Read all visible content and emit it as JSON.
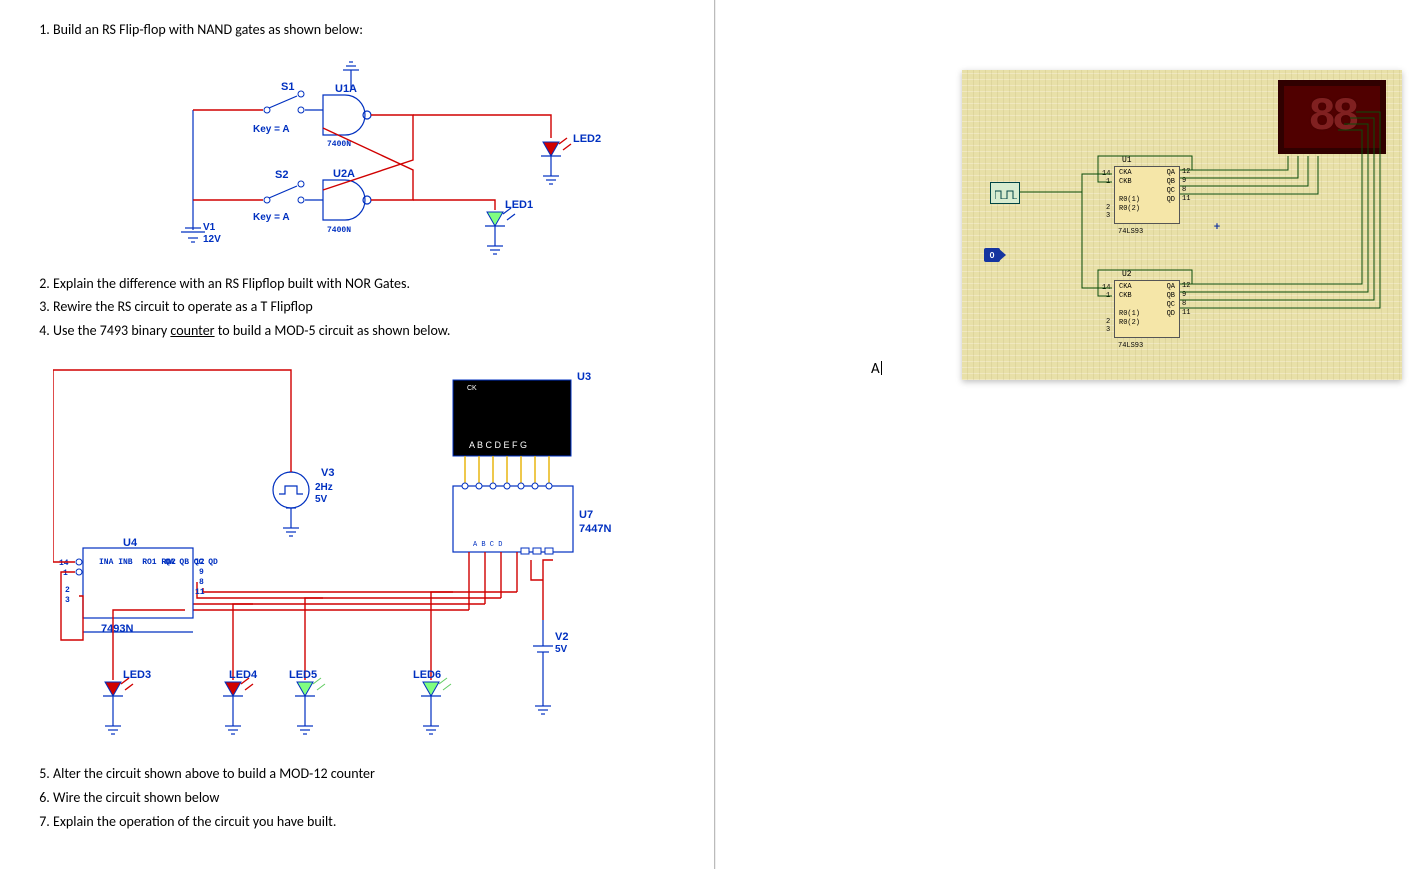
{
  "doc": {
    "items": {
      "q1": "Build an RS Flip-flop with NAND gates as shown below:",
      "q2": "Explain the difference with an RS Flipflop built with NOR Gates.",
      "q3": "Rewire the RS circuit to operate as a T Flipflop",
      "q4_pre": "Use the 7493 binary ",
      "q4_u": "counter",
      "q4_post": " to build a MOD-5 circuit as shown below.",
      "q5": "Alter the circuit shown above to build a MOD-12 counter",
      "q6": "Wire the circuit shown below",
      "q7": "Explain the operation of the circuit you have built."
    },
    "diagram1": {
      "s1": "S1",
      "s2": "S2",
      "u1a": "U1A",
      "u2a": "U2A",
      "n7400": "7400N",
      "keyA": "Key = A",
      "v1": "V1",
      "v1v": "12V",
      "led1": "LED1",
      "led2": "LED2"
    },
    "diagram2": {
      "u3": "U3",
      "u4": "U4",
      "u7": "U7",
      "u7n": "7447N",
      "n7493": "7493N",
      "v3": "V3",
      "v3l1": "2Hz",
      "v3l2": "5V",
      "v2": "V2",
      "v2v": "5V",
      "led3": "LED3",
      "led4": "LED4",
      "led5": "LED5",
      "led6": "LED6",
      "abcdefg": "A B C D E F G",
      "pins_u4_l": "INA\nINB\n\nRO1\nRO2",
      "pins_u4_r": "QA\nQB\nQC\nQD"
    }
  },
  "right": {
    "u1": "U1",
    "u2": "U2",
    "ic_part": "74LS93",
    "ic_pins_l": "CKA\nCKB\n\nR0(1)\nR0(2)",
    "ic_pins_r": "QA\nQB\nQC\nQD",
    "ic_nums_l_top": "14",
    "ic_nums_l_top2": "1",
    "ic_nums_l_bot": "2",
    "ic_nums_l_bot2": "3",
    "ic_nums_r": "12\n9\n8\n11",
    "seg_display": "88",
    "logic0": "0",
    "cursor_text": "A"
  }
}
